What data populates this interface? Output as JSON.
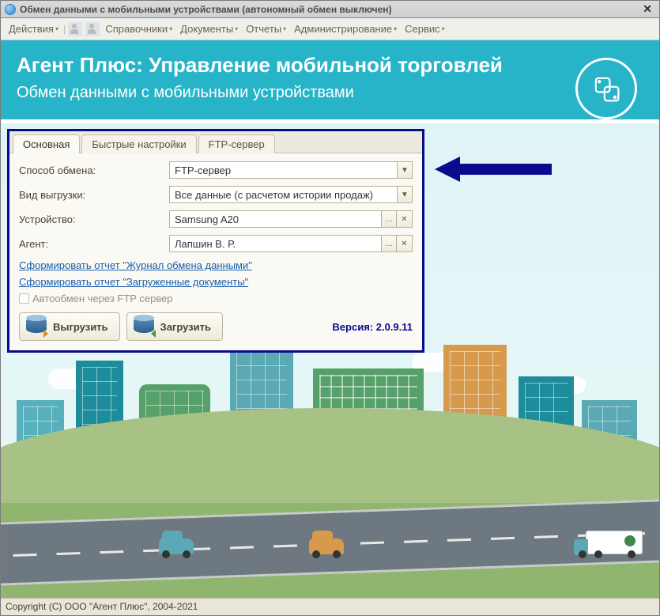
{
  "titlebar": {
    "title": "Обмен данными с мобильными устройствами (автономный обмен выключен)"
  },
  "menu": {
    "actions": "Действия",
    "references": "Справочники",
    "documents": "Документы",
    "reports": "Отчеты",
    "admin": "Администрирование",
    "service": "Сервис"
  },
  "banner": {
    "title": "Агент Плюс: Управление мобильной торговлей",
    "subtitle": "Обмен данными с мобильными устройствами"
  },
  "tabs": {
    "main": "Основная",
    "quick": "Быстрые настройки",
    "ftp": "FTP-сервер"
  },
  "form": {
    "exchange_label": "Способ обмена:",
    "exchange_value": "FTP-сервер",
    "export_type_label": "Вид выгрузки:",
    "export_type_value": "Все данные (с расчетом истории продаж)",
    "device_label": "Устройство:",
    "device_value": "Samsung A20",
    "agent_label": "Агент:",
    "agent_value": "Лапшин В. Р.",
    "link_report_journal": "Сформировать отчет \"Журнал обмена данными\"",
    "link_report_docs": "Сформировать отчет \"Загруженные документы\"",
    "autoexchange_label": "Автообмен через FTP сервер",
    "export_btn": "Выгрузить",
    "import_btn": "Загрузить",
    "version_label": "Версия: 2.0.9.11"
  },
  "footer": {
    "copyright": "Copyright (C) ООО \"Агент Плюс\", 2004-2021"
  }
}
